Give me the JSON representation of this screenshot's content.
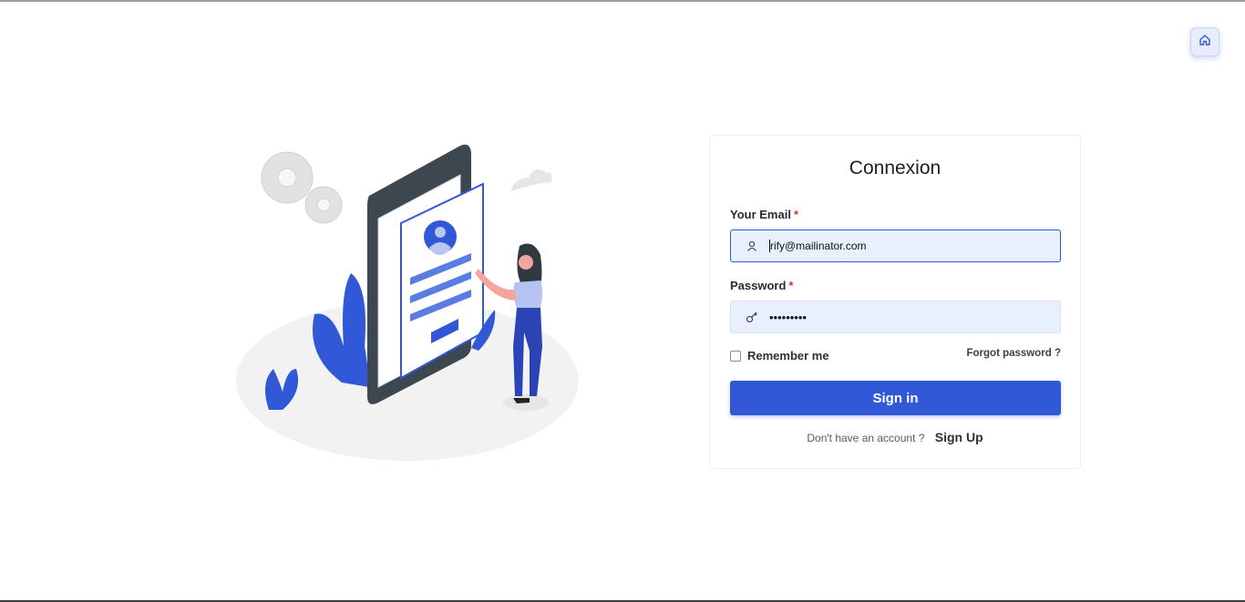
{
  "header": {
    "home_icon": "home-icon"
  },
  "login": {
    "title": "Connexion",
    "email_label": "Your Email",
    "email_required": "*",
    "email_value": "rify@mailinator.com",
    "email_icon": "user-icon",
    "password_label": "Password",
    "password_required": "*",
    "password_value": "•••••••••",
    "password_icon": "key-icon",
    "remember_label": "Remember me",
    "remember_checked": false,
    "forgot_label": "Forgot password ?",
    "signin_label": "Sign in",
    "no_account_text": "Don't have an account ?",
    "signup_label": "Sign Up"
  },
  "colors": {
    "accent": "#3158d6",
    "field_bg": "#e8f0fe",
    "required": "#e03131"
  }
}
